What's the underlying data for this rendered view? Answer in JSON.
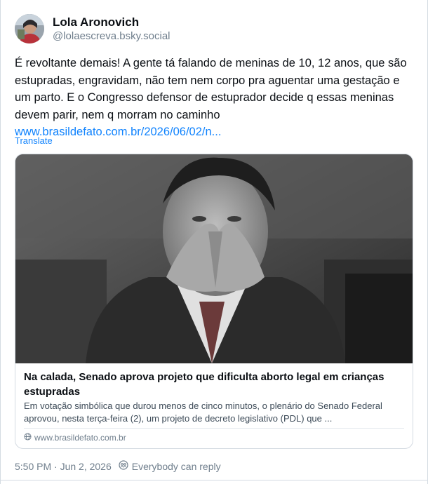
{
  "author": {
    "display_name": "Lola Aronovich",
    "handle": "@lolaescreva.bsky.social"
  },
  "post": {
    "text": "É revoltante demais! A gente tá falando de meninas de 10, 12 anos, que são estupradas, engravidam, não tem nem corpo pra aguentar uma gestação e um parto. E o Congresso defensor de estuprador decide q essas meninas devem parir, nem q morram no caminho",
    "link_text": "www.brasildefato.com.br/2026/06/02/n...",
    "translate_label": "Translate"
  },
  "link_card": {
    "title": "Na calada, Senado aprova projeto que dificulta aborto legal em crianças estupradas",
    "description": "Em votação simbólica que durou menos de cinco minutos, o plenário do Senado Federal aprovou, nesta terça-feira (2), um projeto de decreto legislativo (PDL) que ...",
    "domain": "www.brasildefato.com.br"
  },
  "meta": {
    "timestamp": "5:50 PM · Jun 2, 2026",
    "reply_setting": "Everybody can reply"
  },
  "icons": {
    "globe": "globe-icon",
    "reply_setting": "reply-setting-icon"
  },
  "colors": {
    "link": "#1083fe",
    "text": "#0b0f14",
    "muted": "#6f7e8c",
    "border": "#d4dbe2"
  }
}
